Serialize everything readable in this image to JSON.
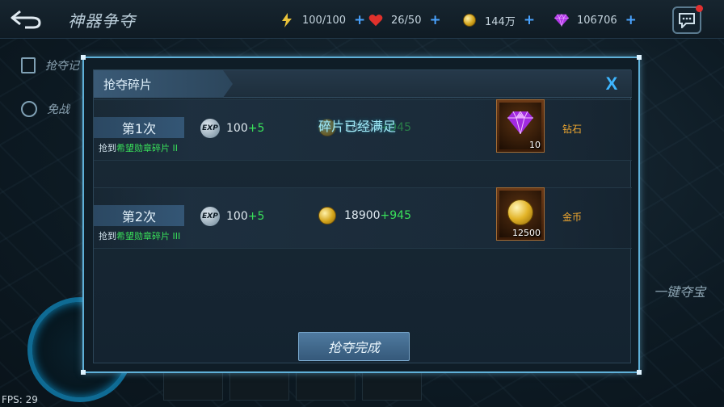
{
  "topbar": {
    "back_icon": "back-arrow-icon",
    "title": "神器争夺",
    "resources": {
      "energy": {
        "icon": "lightning-icon",
        "value": "100/100"
      },
      "stamina": {
        "icon": "heart-icon",
        "value": "26/50"
      },
      "gold": {
        "icon": "gold-coin-icon",
        "value": "144万"
      },
      "gems": {
        "icon": "gem-icon",
        "value": "106706"
      },
      "plus": "+"
    },
    "chat_icon": "chat-icon"
  },
  "background": {
    "left_items": [
      "抢夺记",
      "免战"
    ],
    "right_button": "一键夺宝",
    "fps": "FPS: 29"
  },
  "modal": {
    "title": "抢夺碎片",
    "close_label": "X",
    "rows": [
      {
        "attempt": "第1次",
        "loot_prefix": "抢到",
        "loot_item": "希望勋章碎片 II",
        "exp_badge": "EXP",
        "exp_base": "100",
        "exp_bonus": "+5",
        "gold_base": "18900",
        "gold_bonus": "+945",
        "status_message": "碎片已经满足",
        "reward_icon": "diamond-gem-icon",
        "reward_count": "10",
        "reward_name": "钻石"
      },
      {
        "attempt": "第2次",
        "loot_prefix": "抢到",
        "loot_item": "希望勋章碎片 III",
        "exp_badge": "EXP",
        "exp_base": "100",
        "exp_bonus": "+5",
        "gold_base": "18900",
        "gold_bonus": "+945",
        "reward_icon": "gold-coin-icon",
        "reward_count": "12500",
        "reward_name": "金币"
      }
    ],
    "finish_button": "抢夺完成"
  },
  "colors": {
    "accent_blue": "#3eb6ff",
    "bonus_green": "#39e05a",
    "reward_orange": "#f0a830",
    "frame_border": "#5fb0d8"
  }
}
